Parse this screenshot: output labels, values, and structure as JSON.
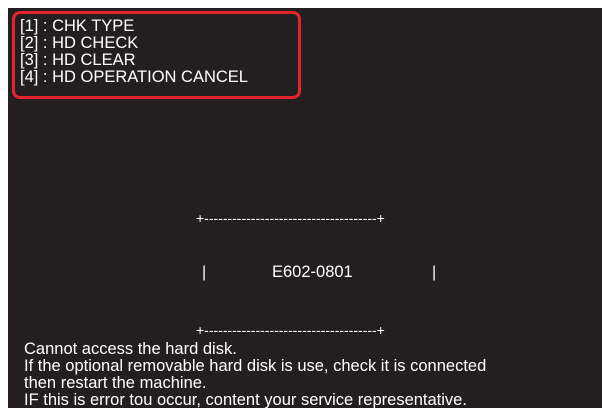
{
  "menu": {
    "items": [
      {
        "label": "[1] : CHK TYPE"
      },
      {
        "label": "[2] : HD CHECK"
      },
      {
        "label": "[3] : HD CLEAR"
      },
      {
        "label": "[4] : HD OPERATION CANCEL"
      }
    ]
  },
  "error_box": {
    "top_border": "+-------------------------------------+",
    "left_bar": "|",
    "code": "E602-0801",
    "right_bar": "|",
    "bottom_border": "+-------------------------------------+"
  },
  "message": {
    "lines": [
      "Cannot access the hard disk.",
      "If the optional removable hard disk is use, check it is connected",
      "then restart the machine.",
      "IF this is error tou occur, content your service representative."
    ]
  },
  "colors": {
    "screen_background": "#231f20",
    "text": "#ffffff",
    "highlight_border": "#e3242b"
  }
}
